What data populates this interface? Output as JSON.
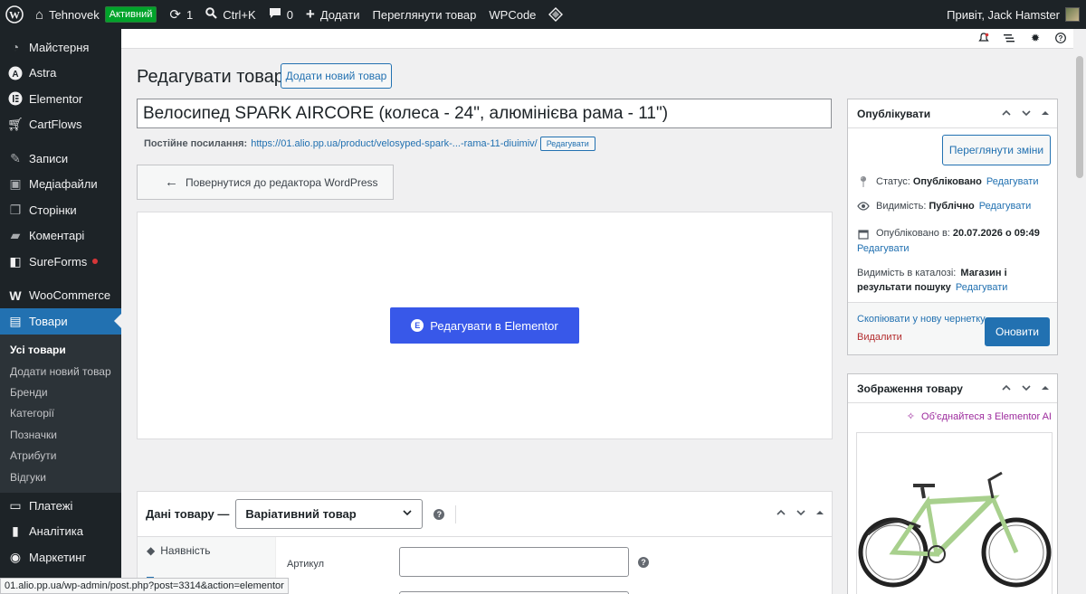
{
  "adminbar": {
    "site_name": "Tehnovek",
    "badge": "Активний",
    "updates_count": "1",
    "search_shortcut": "Ctrl+K",
    "comments_count": "0",
    "add_label": "Додати",
    "view_product": "Переглянути товар",
    "wpcode": "WPCode",
    "greeting": "Привіт, Jack Hamster"
  },
  "sidebar": {
    "items": [
      {
        "label": "Майстерня",
        "icon": "dashboard-icon"
      },
      {
        "label": "Astra",
        "icon": "astra-icon"
      },
      {
        "label": "Elementor",
        "icon": "elementor-icon"
      },
      {
        "label": "CartFlows",
        "icon": "cartflows-icon"
      },
      {
        "label": "Записи",
        "icon": "pin-icon"
      },
      {
        "label": "Медіафайли",
        "icon": "media-icon"
      },
      {
        "label": "Сторінки",
        "icon": "pages-icon"
      },
      {
        "label": "Коментарі",
        "icon": "comments-icon"
      },
      {
        "label": "SureForms",
        "icon": "sureforms-icon"
      },
      {
        "label": "WooCommerce",
        "icon": "woo-icon"
      },
      {
        "label": "Товари",
        "icon": "products-icon"
      },
      {
        "label": "Платежі",
        "icon": "payments-icon"
      },
      {
        "label": "Аналітика",
        "icon": "analytics-icon"
      },
      {
        "label": "Маркетинг",
        "icon": "marketing-icon"
      }
    ],
    "submenu": [
      "Усі товари",
      "Додати новий товар",
      "Бренди",
      "Категорії",
      "Позначки",
      "Атрибути",
      "Відгуки"
    ]
  },
  "page": {
    "title": "Редагувати товар",
    "add_new": "Додати новий товар",
    "product_title": "Велосипед SPARK AIRCORE (колеса - 24\", алюмінієва рама - 11\")",
    "permalink_label": "Постійне посилання:",
    "permalink_url": "https://01.alio.pp.ua/product/velosyped-spark-...-rama-11-diuimiv/",
    "permalink_edit": "Редагувати",
    "back_to_wp": "Повернутися до редактора WordPress",
    "edit_elementor": "Редагувати в Elementor"
  },
  "product_data": {
    "label": "Дані товару —",
    "type": "Варіативний товар",
    "tabs": [
      "Наявність",
      ""
    ],
    "sku_label": "Артикул"
  },
  "publish": {
    "title": "Опублікувати",
    "preview": "Переглянути зміни",
    "status_label": "Статус:",
    "status_value": "Опубліковано",
    "visibility_label": "Видимість:",
    "visibility_value": "Публічно",
    "published_label": "Опубліковано в:",
    "published_value": "20.07.2026 о 09:49",
    "catalog_label": "Видимість в каталозі:",
    "catalog_value": "Магазин і результати пошуку",
    "edit": "Редагувати",
    "copy_draft": "Скопіювати у нову чернетку",
    "trash": "Видалити",
    "update": "Оновити"
  },
  "product_image": {
    "title": "Зображення товару",
    "ai_link": "Об'єднайтеся з Elementor AI"
  },
  "statusbar": {
    "url": "01.alio.pp.ua/wp-admin/post.php?post=3314&action=elementor"
  },
  "colors": {
    "adminbar": "#1d2327",
    "accent": "#2271b1",
    "elementor": "#3858e9",
    "bike_frame": "#a8d08d"
  }
}
